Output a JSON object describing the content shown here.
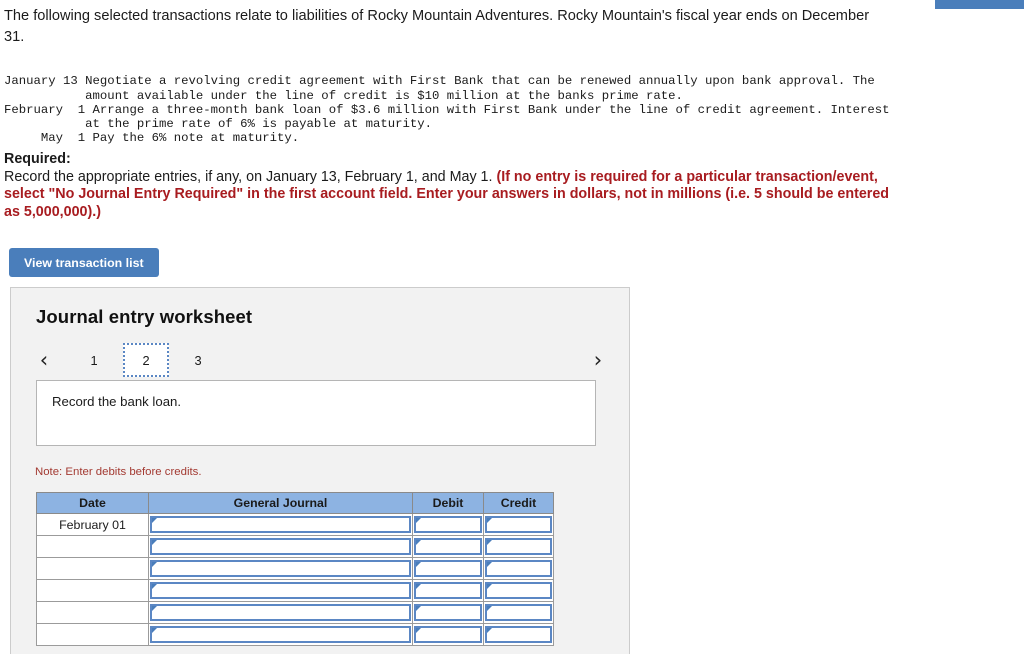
{
  "top_bar": {
    "visible": true,
    "color": "#4a7ebb"
  },
  "intro": {
    "text": "The following selected transactions relate to liabilities of Rocky Mountain Adventures. Rocky Mountain's fiscal year ends on December 31."
  },
  "transactions": {
    "monospace_block": "January 13 Negotiate a revolving credit agreement with First Bank that can be renewed annually upon bank approval. The\n           amount available under the line of credit is $10 million at the banks prime rate.\nFebruary  1 Arrange a three-month bank loan of $3.6 million with First Bank under the line of credit agreement. Interest\n           at the prime rate of 6% is payable at maturity.\n     May  1 Pay the 6% note at maturity.",
    "rows": [
      {
        "date": "January 13",
        "description": "Negotiate a revolving credit agreement with First Bank that can be renewed annually upon bank approval. The amount available under the line of credit is $10 million at the banks prime rate."
      },
      {
        "date": "February 1",
        "description": "Arrange a three-month bank loan of $3.6 million with First Bank under the line of credit agreement. Interest at the prime rate of 6% is payable at maturity."
      },
      {
        "date": "May 1",
        "description": "Pay the 6% note at maturity."
      }
    ]
  },
  "required": {
    "label": "Required:",
    "body_plain": "Record the appropriate entries, if any, on January 13, February 1, and May 1. ",
    "body_red": "(If no entry is required for a particular transaction/event, select \"No Journal Entry Required\" in the first account field. Enter your answers in dollars, not in millions (i.e. 5 should be entered as 5,000,000).)",
    "red_color": "#a81c20"
  },
  "buttons": {
    "view_transaction_list": "View transaction list"
  },
  "worksheet": {
    "title": "Journal entry worksheet",
    "prev_icon": "‹",
    "next_icon": "›",
    "pages": [
      {
        "label": "1",
        "selected": false
      },
      {
        "label": "2",
        "selected": true
      },
      {
        "label": "3",
        "selected": false
      }
    ],
    "prompt": "Record the bank loan.",
    "note": "Note: Enter debits before credits.",
    "accent_color": "#4a7ebb",
    "header_color": "#8db3e2"
  },
  "journal_table": {
    "headers": [
      "Date",
      "General Journal",
      "Debit",
      "Credit"
    ],
    "rows": [
      {
        "date": "February 01",
        "general_journal": "",
        "debit": "",
        "credit": ""
      },
      {
        "date": "",
        "general_journal": "",
        "debit": "",
        "credit": ""
      },
      {
        "date": "",
        "general_journal": "",
        "debit": "",
        "credit": ""
      },
      {
        "date": "",
        "general_journal": "",
        "debit": "",
        "credit": ""
      },
      {
        "date": "",
        "general_journal": "",
        "debit": "",
        "credit": ""
      },
      {
        "date": "",
        "general_journal": "",
        "debit": "",
        "credit": ""
      }
    ]
  }
}
